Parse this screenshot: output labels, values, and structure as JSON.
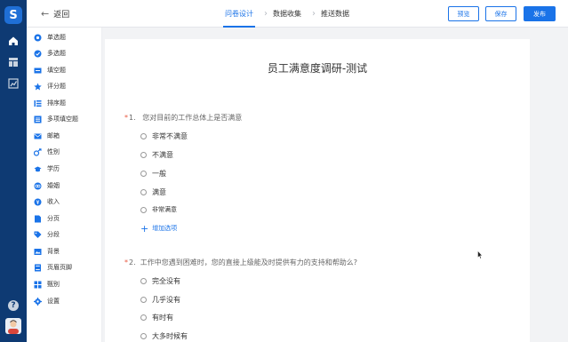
{
  "leftbar": {
    "logo_glyph": "S"
  },
  "topbar": {
    "back_label": "返回",
    "steps": [
      "问卷设计",
      "数据收集",
      "推送数据"
    ],
    "preview_label": "预览",
    "save_label": "保存",
    "publish_label": "发布"
  },
  "question_types": [
    {
      "label": "单选题",
      "icon": "radio-icon"
    },
    {
      "label": "多选题",
      "icon": "checkbox-icon"
    },
    {
      "label": "填空题",
      "icon": "fill-blank-icon"
    },
    {
      "label": "评分题",
      "icon": "star-icon"
    },
    {
      "label": "排序题",
      "icon": "sort-icon"
    },
    {
      "label": "多项填空题",
      "icon": "multi-fill-icon"
    },
    {
      "label": "邮箱",
      "icon": "mail-icon"
    },
    {
      "label": "性别",
      "icon": "gender-icon"
    },
    {
      "label": "学历",
      "icon": "education-icon"
    },
    {
      "label": "婚姻",
      "icon": "marriage-icon"
    },
    {
      "label": "收入",
      "icon": "income-icon"
    },
    {
      "label": "分页",
      "icon": "page-icon"
    },
    {
      "label": "分段",
      "icon": "tag-icon"
    },
    {
      "label": "背景",
      "icon": "background-icon"
    },
    {
      "label": "页眉页脚",
      "icon": "header-footer-icon"
    },
    {
      "label": "甄别",
      "icon": "screening-icon"
    },
    {
      "label": "设置",
      "icon": "settings-icon"
    }
  ],
  "survey": {
    "title": "员工满意度调研-测试",
    "q1": {
      "required_mark": "*",
      "number": "1.",
      "text": "您对目前的工作总体上是否满意",
      "options": [
        "非常不满意",
        "不满意",
        "一般",
        "满意",
        "非常满意"
      ]
    },
    "add_option_label": "增加选项",
    "q2": {
      "required_mark": "*",
      "number": "2.",
      "text": "工作中您遇到困难时，您的直接上级能及时提供有力的支持和帮助么?",
      "options": [
        "完全没有",
        "几乎没有",
        "有时有",
        "大多时候有"
      ]
    }
  },
  "colors": {
    "accent": "#1a73e8",
    "sidebar_bg": "#0e3a73",
    "required": "#e8583f"
  }
}
